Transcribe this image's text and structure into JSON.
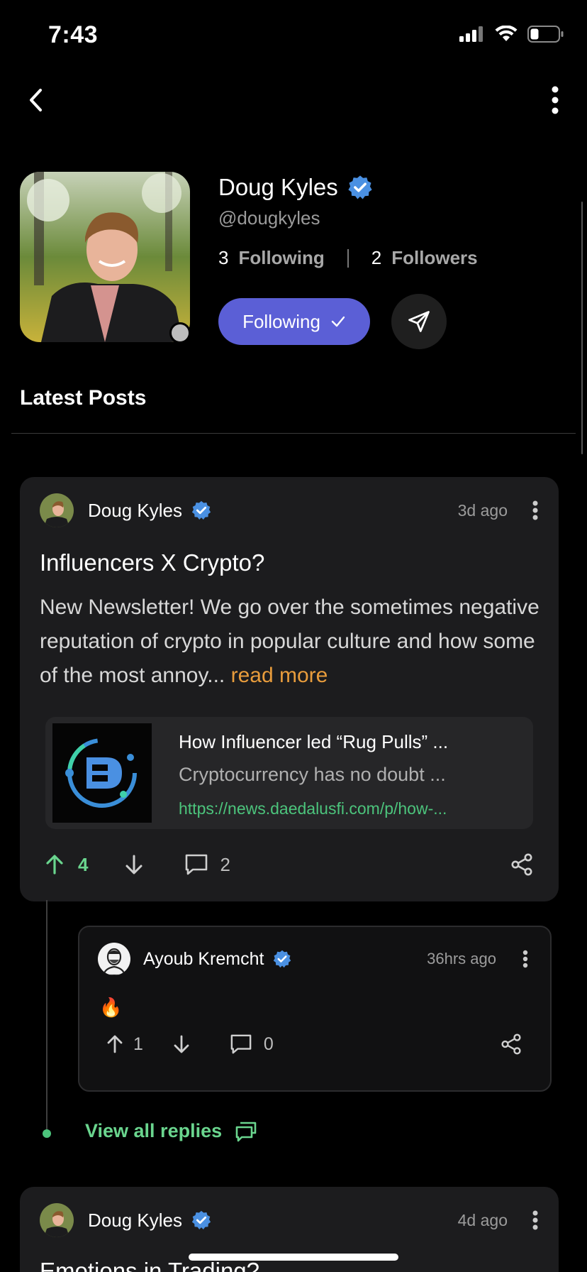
{
  "status_bar": {
    "time": "7:43"
  },
  "profile": {
    "name": "Doug Kyles",
    "handle": "@dougkyles",
    "following_count": "3",
    "following_label": "Following",
    "followers_count": "2",
    "followers_label": "Followers",
    "follow_button_label": "Following"
  },
  "section_title": "Latest Posts",
  "posts": [
    {
      "author": "Doug Kyles",
      "time_ago": "3d ago",
      "title": "Influencers X Crypto?",
      "body": "New Newsletter! We go over the sometimes negative reputation of crypto in popular culture and how some of the most annoy...",
      "read_more": "read more",
      "link": {
        "title": "How Influencer led “Rug Pulls” ...",
        "description": "Cryptocurrency has no doubt ...",
        "url": "https://news.daedalusfi.com/p/how-..."
      },
      "upvotes": "4",
      "comments": "2"
    },
    {
      "author": "Doug Kyles",
      "time_ago": "4d ago",
      "title": "Emotions in Trading?"
    }
  ],
  "reply": {
    "author": "Ayoub Kremcht",
    "time_ago": "36hrs ago",
    "body": "🔥",
    "upvotes": "1",
    "comments": "0"
  },
  "view_all_replies": "View all replies",
  "colors": {
    "accent_button": "#5b5fd6",
    "verified_badge": "#4a90e2",
    "upvote_active": "#6ad58e",
    "read_more": "#e89c3c",
    "link_url": "#4cc47c"
  }
}
